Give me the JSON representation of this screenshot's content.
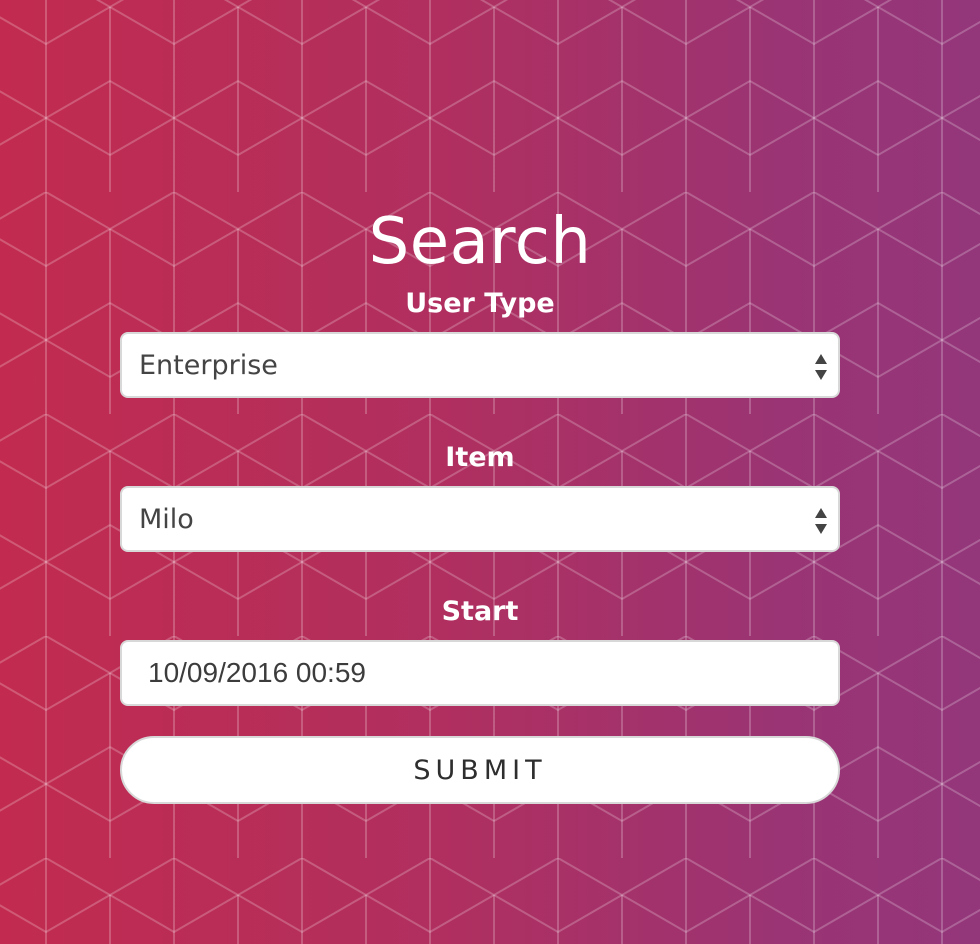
{
  "page": {
    "title": "Search",
    "background_colors": [
      "#c22b4f",
      "#93367a"
    ]
  },
  "form": {
    "user_type": {
      "label": "User Type",
      "value": "Enterprise",
      "icon": "select-arrows-icon"
    },
    "item": {
      "label": "Item",
      "value": "Milo",
      "icon": "select-arrows-icon"
    },
    "start": {
      "label": "Start",
      "value": "10/09/2016 00:59"
    },
    "submit_label": "SUBMIT"
  }
}
